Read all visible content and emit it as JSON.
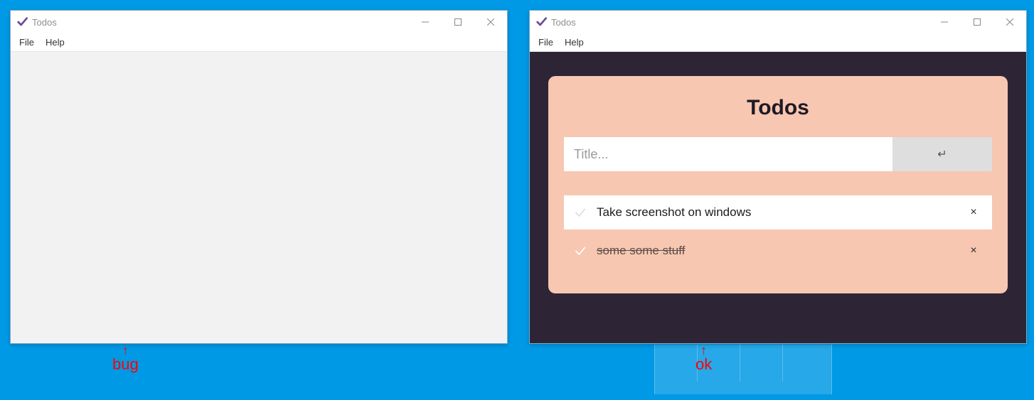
{
  "app_title": "Todos",
  "menu": {
    "file": "File",
    "help": "Help"
  },
  "right": {
    "heading": "Todos",
    "input_placeholder": "Title...",
    "submit_glyph": "↵",
    "todos": [
      {
        "label": "Take screenshot on windows",
        "done": false
      },
      {
        "label": "some some stuff",
        "done": true
      }
    ],
    "delete_glyph": "×"
  },
  "annotations": {
    "left": "bug",
    "right": "ok"
  }
}
